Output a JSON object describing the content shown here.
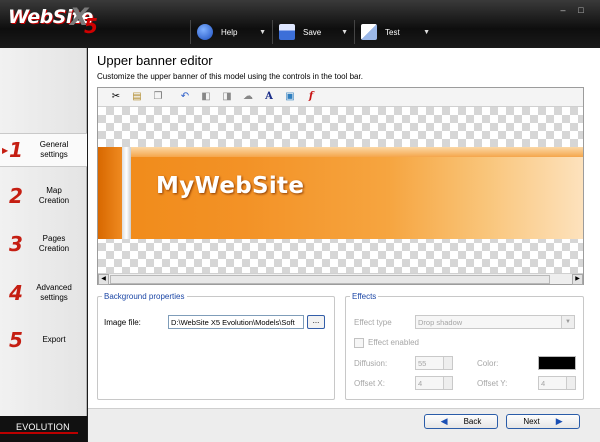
{
  "app": {
    "logo_main": "WebSite",
    "logo_x": "X",
    "logo_num": "5",
    "edition": "EVOLUTION"
  },
  "window_controls": [
    "–",
    "□"
  ],
  "toolbar": {
    "help_label": "Help",
    "save_label": "Save",
    "test_label": "Test"
  },
  "sidebar": {
    "steps": [
      {
        "num": "1",
        "label": "General settings"
      },
      {
        "num": "2",
        "label": "Map Creation"
      },
      {
        "num": "3",
        "label": "Pages Creation"
      },
      {
        "num": "4",
        "label": "Advanced settings"
      },
      {
        "num": "5",
        "label": "Export"
      }
    ]
  },
  "page": {
    "title": "Upper banner editor",
    "subtitle": "Customize the upper banner of this model using the controls in the tool bar."
  },
  "editor": {
    "tools": [
      "cut-icon",
      "paste-icon",
      "copy-icon",
      "undo-icon",
      "bring-forward-icon",
      "send-backward-icon",
      "effects-icon",
      "text-icon",
      "image-icon",
      "flash-icon"
    ],
    "banner_text": "MyWebSite",
    "accent_color": "#f39226"
  },
  "background": {
    "legend": "Background properties",
    "image_label": "Image file:",
    "image_value": "D:\\WebSite X5 Evolution\\Models\\Soft",
    "browse_label": "..."
  },
  "effects": {
    "legend": "Effects",
    "type_label": "Effect type",
    "type_value": "Drop shadow",
    "enabled_label": "Effect enabled",
    "diffusion_label": "Diffusion:",
    "diffusion_value": "55",
    "color_label": "Color:",
    "offset_x_label": "Offset X:",
    "offset_x_value": "4",
    "offset_y_label": "Offset Y:",
    "offset_y_value": "4"
  },
  "nav": {
    "back_label": "Back",
    "next_label": "Next"
  }
}
